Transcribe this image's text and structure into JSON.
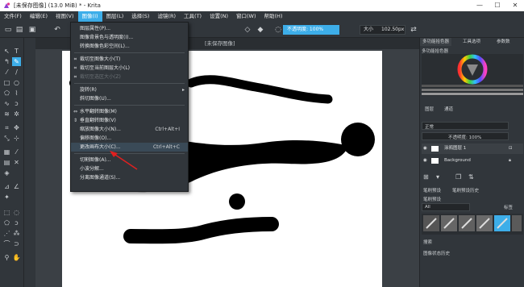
{
  "window": {
    "title": "[未保存图像]  (13.0 MiB)  * - Krita",
    "minimize": "—",
    "maximize": "☐",
    "close": "✕"
  },
  "menubar": {
    "items": [
      "文件(F)",
      "编辑(E)",
      "视图(V)",
      "图像(I)",
      "图层(L)",
      "选择(S)",
      "滤镜(R)",
      "工具(T)",
      "设置(N)",
      "窗口(W)",
      "帮助(H)"
    ],
    "active_index": 3
  },
  "toolbar": {
    "opacity_label": "不透明度: 100%",
    "size_label": "大小",
    "size_value": "102.50px"
  },
  "canvas": {
    "tab_title": "[未保存图像]"
  },
  "image_menu": {
    "items": [
      {
        "label": "图层属性(P)...",
        "shortcut": "",
        "icon": "",
        "disabled": false
      },
      {
        "label": "图像背景色与透明度(I)...",
        "shortcut": "",
        "icon": "",
        "disabled": false
      },
      {
        "label": "转换图像色彩空间(L)...",
        "shortcut": "",
        "icon": "",
        "disabled": false
      },
      {
        "sep": true
      },
      {
        "label": "裁切至图像大小(T)",
        "shortcut": "",
        "icon": "crop-icon",
        "disabled": false
      },
      {
        "label": "裁切至当前图层大小(L)",
        "shortcut": "",
        "icon": "crop-icon",
        "disabled": false
      },
      {
        "label": "裁切至选区大小(Z)",
        "shortcut": "",
        "icon": "crop-icon",
        "disabled": true
      },
      {
        "sep": true
      },
      {
        "label": "旋转(R)",
        "shortcut": "",
        "icon": "",
        "disabled": false,
        "submenu": true
      },
      {
        "label": "斜切图像(U)...",
        "shortcut": "",
        "icon": "",
        "disabled": false
      },
      {
        "sep": true
      },
      {
        "label": "水平翻转图像(M)",
        "shortcut": "",
        "icon": "flip-h-icon",
        "disabled": false
      },
      {
        "label": "垂直翻转图像(V)",
        "shortcut": "",
        "icon": "flip-v-icon",
        "disabled": false
      },
      {
        "label": "缩放图像大小(N)...",
        "shortcut": "Ctrl+Alt+I",
        "icon": "",
        "disabled": false
      },
      {
        "label": "偏移图像(O)...",
        "shortcut": "",
        "icon": "",
        "disabled": false
      },
      {
        "label": "更改画布大小(C)...",
        "shortcut": "Ctrl+Alt+C",
        "icon": "",
        "disabled": false,
        "hover": true
      },
      {
        "sep": true
      },
      {
        "label": "切割图像(A)...",
        "shortcut": "",
        "icon": "",
        "disabled": false
      },
      {
        "label": "小波分解...",
        "shortcut": "",
        "icon": "",
        "disabled": false
      },
      {
        "label": "分离图像通道(S)...",
        "shortcut": "",
        "icon": "",
        "disabled": false
      }
    ]
  },
  "dock": {
    "color_tabs": [
      "多功能拾色器",
      "工具选项",
      "参数数"
    ],
    "color_title": "多功能拾色器",
    "layer_tabs": [
      "图层",
      "通道"
    ],
    "blend_mode": "正常",
    "layer_opacity": "不透明度:  100%",
    "layers": [
      {
        "name": "涂鸦图层 1",
        "active": true
      },
      {
        "name": "Background",
        "active": false
      }
    ],
    "brush_tabs": [
      "笔刷预设",
      "笔刷预设历史"
    ],
    "brush_title": "笔刷预设",
    "brush_filter": "All",
    "brush_tag": "标签",
    "search_label": "搜索",
    "history_label": "图像状态历史"
  },
  "colors": {
    "accent": "#3daee9",
    "bg": "#31363b",
    "canvas": "#ffffff",
    "arrow": "#e02020"
  }
}
